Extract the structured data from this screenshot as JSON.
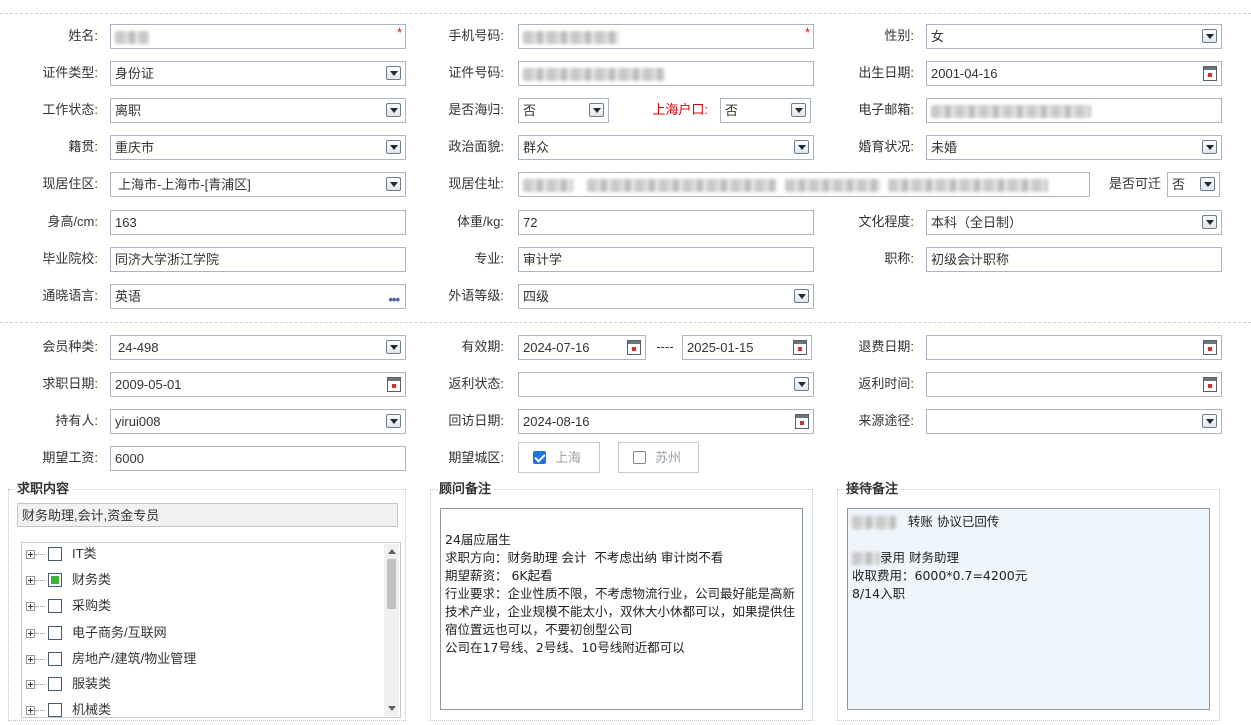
{
  "fields": {
    "name": {
      "label": "姓名:"
    },
    "phone": {
      "label": "手机号码:"
    },
    "gender": {
      "label": "性别:",
      "value": "女"
    },
    "id_type": {
      "label": "证件类型:",
      "value": "身份证"
    },
    "id_number": {
      "label": "证件号码:"
    },
    "birth_date": {
      "label": "出生日期:",
      "value": "2001-04-16"
    },
    "work_status": {
      "label": "工作状态:",
      "value": "离职"
    },
    "returnee": {
      "label": "是否海归:",
      "value": "否"
    },
    "shanghai_hukou": {
      "label": "上海户口:",
      "value": "否"
    },
    "email": {
      "label": "电子邮箱:"
    },
    "native_place": {
      "label": "籍贯:",
      "value": "重庆市"
    },
    "political": {
      "label": "政治面貌:",
      "value": "群众"
    },
    "marital": {
      "label": "婚育状况:",
      "value": "未婚"
    },
    "current_area": {
      "label": "现居住区:",
      "value": "上海市-上海市-[青浦区]"
    },
    "current_address": {
      "label": "现居住址:"
    },
    "relocatable": {
      "label": "是否可迁",
      "value": "否"
    },
    "height": {
      "label": "身高/cm:",
      "value": "163"
    },
    "weight": {
      "label": "体重/kg:",
      "value": "72"
    },
    "education": {
      "label": "文化程度:",
      "value": "本科（全日制）"
    },
    "school": {
      "label": "毕业院校:",
      "value": "同济大学浙江学院"
    },
    "major": {
      "label": "专业:",
      "value": "审计学"
    },
    "title": {
      "label": "职称:",
      "value": "初级会计职称"
    },
    "languages": {
      "label": "通晓语言:",
      "value": "英语"
    },
    "foreign_level": {
      "label": "外语等级:",
      "value": "四级"
    },
    "member_type": {
      "label": "会员种类:",
      "value": "24-498"
    },
    "valid_period": {
      "label": "有效期:",
      "from": "2024-07-16",
      "sep": "----",
      "to": "2025-01-15"
    },
    "refund_date": {
      "label": "退费日期:",
      "value": ""
    },
    "job_date": {
      "label": "求职日期:",
      "value": "2009-05-01"
    },
    "rebate_status": {
      "label": "返利状态:",
      "value": ""
    },
    "rebate_time": {
      "label": "返利时间:",
      "value": ""
    },
    "holder": {
      "label": "持有人:",
      "value": "yirui008"
    },
    "visit_date": {
      "label": "回访日期:",
      "value": "2024-08-16"
    },
    "source": {
      "label": "来源途径:",
      "value": ""
    },
    "expected_salary": {
      "label": "期望工资:",
      "value": "6000"
    },
    "expected_city": {
      "label": "期望城区:",
      "options": [
        {
          "label": "上海",
          "checked": true
        },
        {
          "label": "苏州",
          "checked": false
        }
      ]
    }
  },
  "job_content": {
    "legend": "求职内容",
    "summary": "财务助理,会计,资金专员",
    "tree": [
      {
        "label": "IT类",
        "checked": false
      },
      {
        "label": "财务类",
        "checked": true
      },
      {
        "label": "采购类",
        "checked": false
      },
      {
        "label": "电子商务/互联网",
        "checked": false
      },
      {
        "label": "房地产/建筑/物业管理",
        "checked": false
      },
      {
        "label": "服装类",
        "checked": false
      },
      {
        "label": "机械类",
        "checked": false
      }
    ]
  },
  "advisor_notes": {
    "legend": "顾问备注",
    "text": "\n24届应届生\n求职方向：财务助理 会计  不考虑出纳 审计岗不看\n期望薪资： 6K起看\n行业要求：企业性质不限，不考虑物流行业，公司最好能是高新技术产业，企业规模不能太小，双休大小休都可以，如果提供住宿位置远也可以，不要初创型公司\n公司在17号线、2号线、10号线附近都可以"
  },
  "reception_notes": {
    "legend": "接待备注",
    "line1": "转账 协议已回传",
    "line3": "录用  财务助理",
    "line4": "收取费用：6000*0.7=4200元",
    "line5": "8/14入职"
  }
}
